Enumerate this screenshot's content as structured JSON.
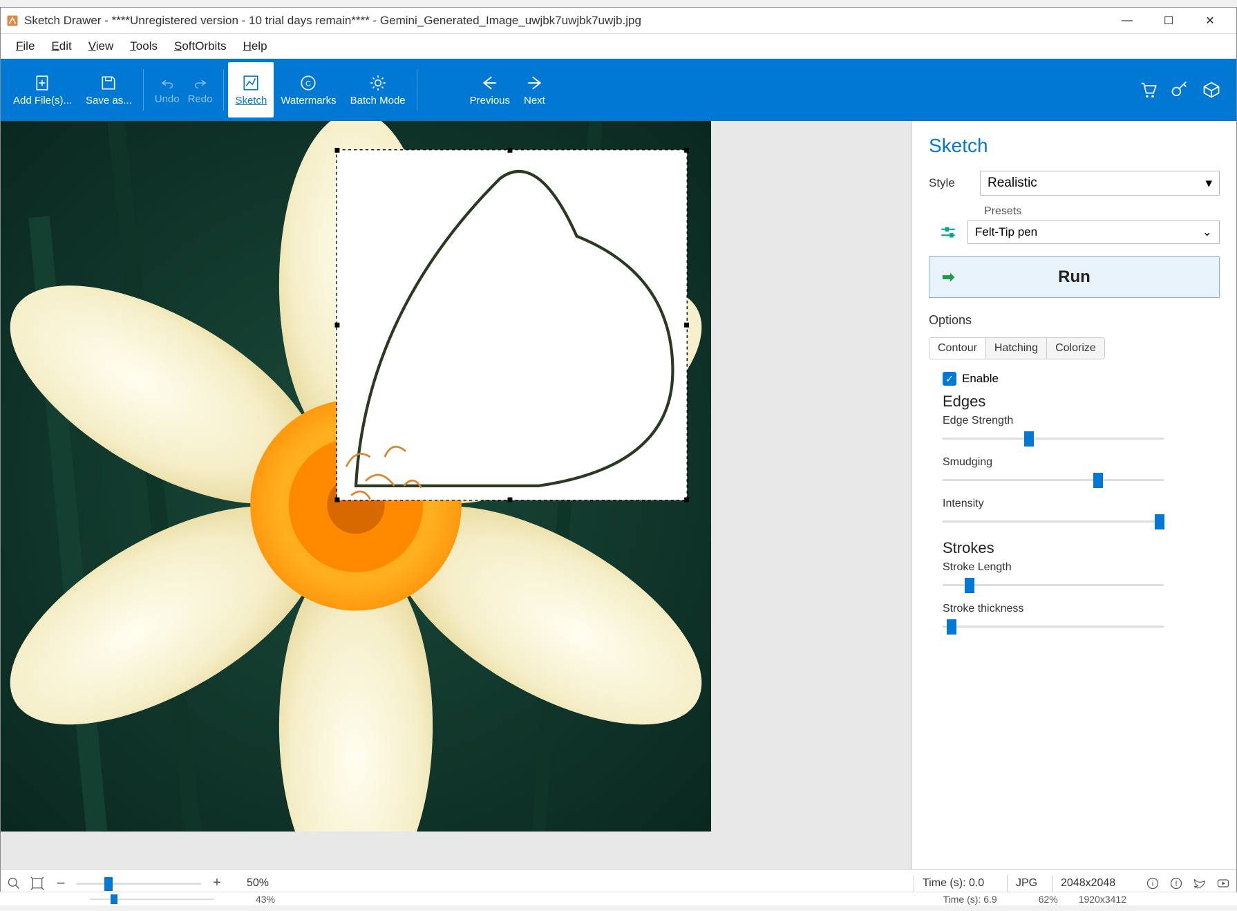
{
  "titlebar": {
    "text": "Sketch Drawer - ****Unregistered version - 10 trial days remain**** - Gemini_Generated_Image_uwjbk7uwjbk7uwjb.jpg"
  },
  "menubar": {
    "file": "File",
    "edit": "Edit",
    "view": "View",
    "tools": "Tools",
    "softorbits": "SoftOrbits",
    "help": "Help"
  },
  "ribbon": {
    "add_files": "Add File(s)...",
    "save_as": "Save as...",
    "undo": "Undo",
    "redo": "Redo",
    "sketch": "Sketch",
    "watermarks": "Watermarks",
    "batch_mode": "Batch Mode",
    "previous": "Previous",
    "next": "Next"
  },
  "panel": {
    "title": "Sketch",
    "style_label": "Style",
    "style_value": "Realistic",
    "presets_label": "Presets",
    "presets_value": "Felt-Tip pen",
    "run": "Run",
    "options": "Options",
    "tabs": {
      "contour": "Contour",
      "hatching": "Hatching",
      "colorize": "Colorize"
    },
    "enable": "Enable",
    "edges_title": "Edges",
    "edge_strength": "Edge Strength",
    "smudging": "Smudging",
    "intensity": "Intensity",
    "strokes_title": "Strokes",
    "stroke_length": "Stroke Length",
    "stroke_thickness": "Stroke thickness",
    "sliders": {
      "edge_strength_pct": 37,
      "smudging_pct": 68,
      "intensity_pct": 96,
      "stroke_length_pct": 10,
      "stroke_thickness_pct": 2
    }
  },
  "statusbar": {
    "zoom": "50%",
    "time": "Time (s): 0.0",
    "format": "JPG",
    "dims": "2048x2048",
    "cutoff_pct": "43%",
    "cutoff_time": "Time (s): 6.9",
    "cutoff_pct2": "62%",
    "cutoff_dims": "1920x3412"
  }
}
